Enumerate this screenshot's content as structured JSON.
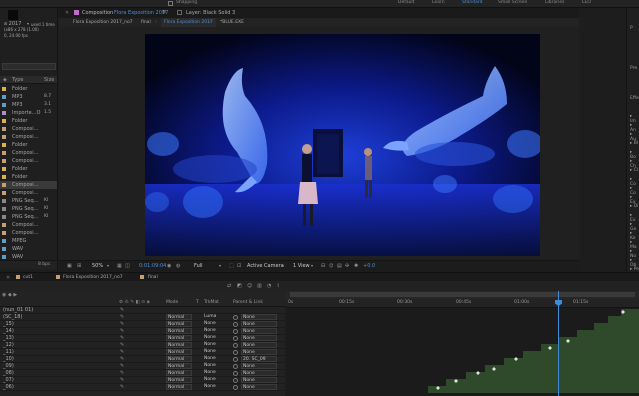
{
  "workspaces": [
    {
      "label": "Shapping",
      "active": false
    },
    {
      "label": "Default",
      "active": false
    },
    {
      "label": "Learn",
      "active": false
    },
    {
      "label": "Standard",
      "active": true
    },
    {
      "label": "Small Screen",
      "active": false
    },
    {
      "label": "Libraries",
      "active": false
    },
    {
      "label": "LEO",
      "active": false
    }
  ],
  "project": {
    "comp_name": "a 2017",
    "comp_info": "used 1 time",
    "comp_dims": "(x86 x 278 (1.00)",
    "comp_fps": "0, 24.00 fps",
    "col_type": "Type",
    "col_size": "Size",
    "items": [
      {
        "type": "Folder",
        "size": "",
        "color": "#d8b24a"
      },
      {
        "type": "MP3",
        "size": "8.7",
        "color": "#5aa0c8"
      },
      {
        "type": "MP3",
        "size": "3.1",
        "color": "#5aa0c8"
      },
      {
        "type": "Importe...O",
        "size": "1.5",
        "color": "#b58cc8"
      },
      {
        "type": "Folder",
        "size": "",
        "color": "#d8b24a"
      },
      {
        "type": "Composi...",
        "size": "",
        "color": "#c8a070"
      },
      {
        "type": "Composi...",
        "size": "",
        "color": "#c8a070"
      },
      {
        "type": "Folder",
        "size": "",
        "color": "#d8b24a"
      },
      {
        "type": "Composi...",
        "size": "",
        "color": "#c8a070"
      },
      {
        "type": "Composi...",
        "size": "",
        "color": "#c8a070"
      },
      {
        "type": "Folder",
        "size": "",
        "color": "#d8b24a"
      },
      {
        "type": "Folder",
        "size": "",
        "color": "#d8b24a"
      },
      {
        "type": "Composi...",
        "size": "",
        "color": "#c8a070",
        "selected": true
      },
      {
        "type": "Composi...",
        "size": "",
        "color": "#c8a070"
      },
      {
        "type": "PNG Seq...",
        "size": "KI",
        "color": "#888888"
      },
      {
        "type": "PNG Seq...",
        "size": "KI",
        "color": "#888888"
      },
      {
        "type": "PNG Seq...",
        "size": "KI",
        "color": "#888888"
      },
      {
        "type": "Composi...",
        "size": "",
        "color": "#c8a070"
      },
      {
        "type": "Composi...",
        "size": "",
        "color": "#c8a070"
      },
      {
        "type": "MPEG",
        "size": "",
        "color": "#5aa0c8"
      },
      {
        "type": "WAV",
        "size": "",
        "color": "#5aa0c8"
      },
      {
        "type": "WAV",
        "size": "",
        "color": "#5aa0c8"
      }
    ],
    "bpc": "8 bpc"
  },
  "comp_panel": {
    "tab_prefix": "Composition",
    "tab_name": "Flora Exposition 2017",
    "layer_tab": "Layer: Black Solid 3",
    "subtabs": [
      "Flora Exposition 2017_no7",
      "final",
      "Flora Exposition 2017",
      "*BLUE.EXE"
    ],
    "zoom": "50%",
    "timecode": "0:01:09:04",
    "resolution": "Full",
    "camera": "Active Camera",
    "views": "1 View",
    "exposure": "+0.0"
  },
  "right_panel": {
    "items": [
      "P",
      "Pre",
      "Effe",
      "▸ Im",
      "▸ An",
      "▸ Au",
      "▸ Bl",
      "▸ Bo",
      "▸ Ch",
      "▸ CI",
      "▸ Co",
      "▸ Co",
      "▸ Ex",
      "▸ Di",
      "▸ Ex",
      "▸ Ge",
      "▸ Ke",
      "▸ Ma",
      "▸ No",
      "▸ Ob",
      "▸ Pe",
      "▸ Re",
      "▸ Re"
    ]
  },
  "timeline": {
    "tabs": [
      "cut1",
      "Flora Exposition 2017_no7",
      "final"
    ],
    "timecode": "",
    "col_mode": "Mode",
    "col_t": "T",
    "col_trkmat": "TrkMat",
    "col_parent": "Parent & Link",
    "ruler": [
      "0s",
      "00:15s",
      "00:30s",
      "00:45s",
      "01:00s",
      "01:15s"
    ],
    "layers": [
      {
        "name": "(nun_01 01)",
        "mode": "",
        "trk": "",
        "parent": ""
      },
      {
        "name": "(SC_18)",
        "mode": "Normal",
        "trk": "Luma",
        "parent": "None"
      },
      {
        "name": "_15)",
        "mode": "Normal",
        "trk": "None",
        "parent": "None"
      },
      {
        "name": "_14)",
        "mode": "Normal",
        "trk": "None",
        "parent": "None"
      },
      {
        "name": "_13)",
        "mode": "Normal",
        "trk": "None",
        "parent": "None"
      },
      {
        "name": "_12)",
        "mode": "Normal",
        "trk": "None",
        "parent": "None"
      },
      {
        "name": "_11)",
        "mode": "Normal",
        "trk": "None",
        "parent": "None"
      },
      {
        "name": "_10)",
        "mode": "Normal",
        "trk": "None",
        "parent": "20. SC_09"
      },
      {
        "name": "_09)",
        "mode": "Normal",
        "trk": "None",
        "parent": "None"
      },
      {
        "name": "_08)",
        "mode": "Normal",
        "trk": "None",
        "parent": "None"
      },
      {
        "name": "_07)",
        "mode": "Normal",
        "trk": "None",
        "parent": "None"
      },
      {
        "name": "_06)",
        "mode": "Normal",
        "trk": "None",
        "parent": "None"
      }
    ],
    "accent": "#3d8bd9"
  }
}
